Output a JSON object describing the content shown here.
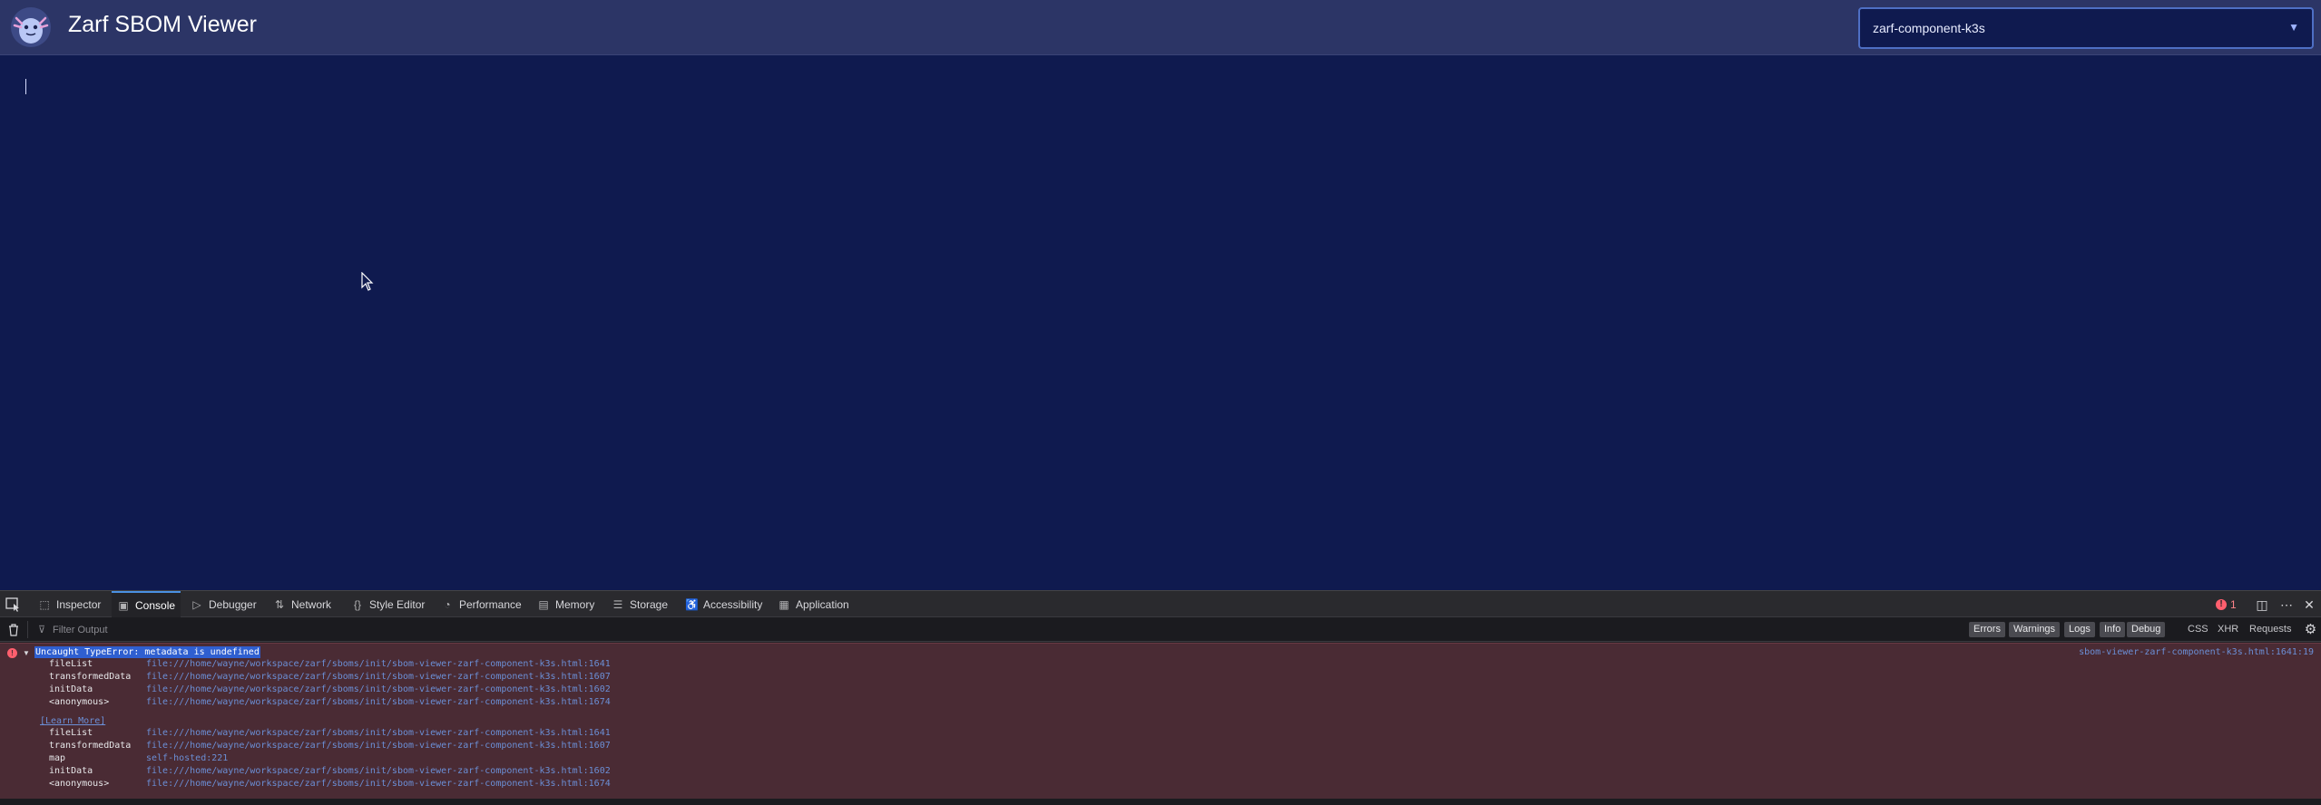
{
  "app": {
    "title": "Zarf SBOM Viewer",
    "component_select": {
      "value": "zarf-component-k3s"
    }
  },
  "devtools": {
    "tabs": [
      {
        "label": "Inspector",
        "icon": "inspector-icon"
      },
      {
        "label": "Console",
        "icon": "console-icon"
      },
      {
        "label": "Debugger",
        "icon": "debugger-icon"
      },
      {
        "label": "Network",
        "icon": "network-icon"
      },
      {
        "label": "Style Editor",
        "icon": "style-editor-icon"
      },
      {
        "label": "Performance",
        "icon": "performance-icon"
      },
      {
        "label": "Memory",
        "icon": "memory-icon"
      },
      {
        "label": "Storage",
        "icon": "storage-icon"
      },
      {
        "label": "Accessibility",
        "icon": "accessibility-icon"
      },
      {
        "label": "Application",
        "icon": "application-icon"
      }
    ],
    "active_tab": "Console",
    "error_count": "1",
    "filter_placeholder": "Filter Output",
    "levels": [
      "Errors",
      "Warnings",
      "Logs",
      "Info",
      "Debug"
    ],
    "categories": [
      "CSS",
      "XHR",
      "Requests"
    ],
    "colors": {
      "error": "#ff5f6e",
      "accent": "#4a90e2",
      "link": "#6b8fd6"
    }
  },
  "console": {
    "error_message": "Uncaught TypeError: metadata is undefined",
    "error_source": "sbom-viewer-zarf-component-k3s.html:1641:19",
    "learn_more": "[Learn More]",
    "stack_before": [
      {
        "fn": "fileList",
        "loc": "file:///home/wayne/workspace/zarf/sboms/init/sbom-viewer-zarf-component-k3s.html:1641"
      },
      {
        "fn": "transformedData",
        "loc": "file:///home/wayne/workspace/zarf/sboms/init/sbom-viewer-zarf-component-k3s.html:1607"
      },
      {
        "fn": "initData",
        "loc": "file:///home/wayne/workspace/zarf/sboms/init/sbom-viewer-zarf-component-k3s.html:1602"
      },
      {
        "fn": "<anonymous>",
        "loc": "file:///home/wayne/workspace/zarf/sboms/init/sbom-viewer-zarf-component-k3s.html:1674"
      }
    ],
    "stack_after": [
      {
        "fn": "fileList",
        "loc": "file:///home/wayne/workspace/zarf/sboms/init/sbom-viewer-zarf-component-k3s.html:1641"
      },
      {
        "fn": "transformedData",
        "loc": "file:///home/wayne/workspace/zarf/sboms/init/sbom-viewer-zarf-component-k3s.html:1607"
      },
      {
        "fn": "map",
        "loc": "self-hosted:221"
      },
      {
        "fn": "initData",
        "loc": "file:///home/wayne/workspace/zarf/sboms/init/sbom-viewer-zarf-component-k3s.html:1602"
      },
      {
        "fn": "<anonymous>",
        "loc": "file:///home/wayne/workspace/zarf/sboms/init/sbom-viewer-zarf-component-k3s.html:1674"
      }
    ]
  }
}
